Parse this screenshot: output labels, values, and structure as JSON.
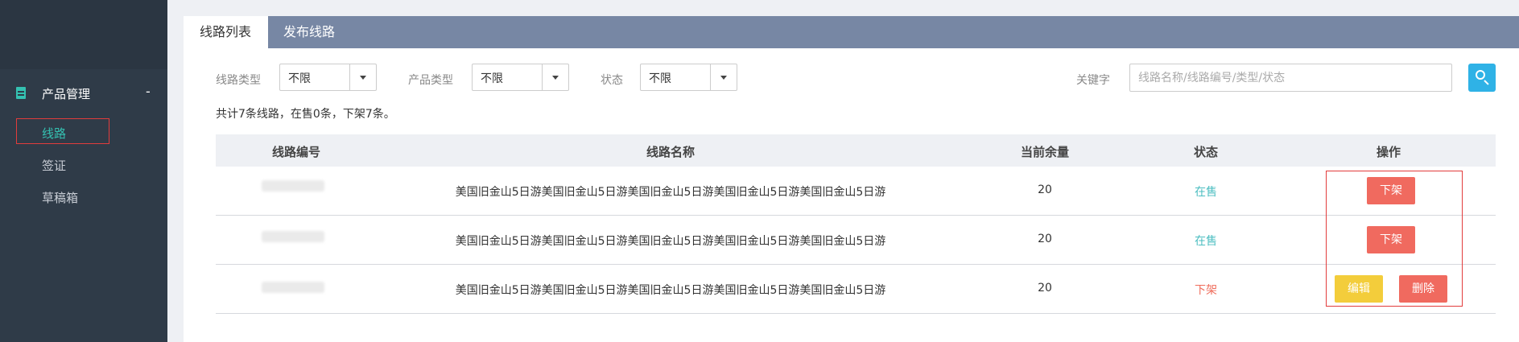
{
  "sidebar": {
    "group_label": "产品管理",
    "group_toggle": "-",
    "items": [
      {
        "label": "线路",
        "active": true
      },
      {
        "label": "签证",
        "active": false
      },
      {
        "label": "草稿箱",
        "active": false
      }
    ],
    "icon": "document-icon"
  },
  "tabs": [
    {
      "label": "线路列表",
      "active": true
    },
    {
      "label": "发布线路",
      "active": false
    }
  ],
  "filters": {
    "route_type": {
      "label": "线路类型",
      "value": "不限"
    },
    "product_type": {
      "label": "产品类型",
      "value": "不限"
    },
    "status": {
      "label": "状态",
      "value": "不限"
    },
    "keyword": {
      "label": "关键字",
      "placeholder": "线路名称/线路编号/类型/状态",
      "value": ""
    }
  },
  "summary": "共计7条线路，在售0条，下架7条。",
  "table": {
    "columns": [
      "线路编号",
      "线路名称",
      "当前余量",
      "状态",
      "操作"
    ],
    "rows": [
      {
        "code": "",
        "name": "美国旧金山5日游美国旧金山5日游美国旧金山5日游美国旧金山5日游美国旧金山5日游",
        "stock": "20",
        "status": "在售",
        "actions": [
          "下架"
        ]
      },
      {
        "code": "",
        "name": "美国旧金山5日游美国旧金山5日游美国旧金山5日游美国旧金山5日游美国旧金山5日游",
        "stock": "20",
        "status": "在售",
        "actions": [
          "下架"
        ]
      },
      {
        "code": "",
        "name": "美国旧金山5日游美国旧金山5日游美国旧金山5日游美国旧金山5日游美国旧金山5日游",
        "stock": "20",
        "status": "下架",
        "actions": [
          "编辑",
          "删除"
        ]
      }
    ]
  },
  "colors": {
    "sidebar_bg": "#2f3b48",
    "accent_teal": "#34c1b1",
    "tabbar_bg": "#7787a4",
    "search_blue": "#2fb2e6",
    "button_red": "#f06a5f",
    "button_yellow": "#f3cd3b",
    "annotation_red": "#e23c3c"
  }
}
